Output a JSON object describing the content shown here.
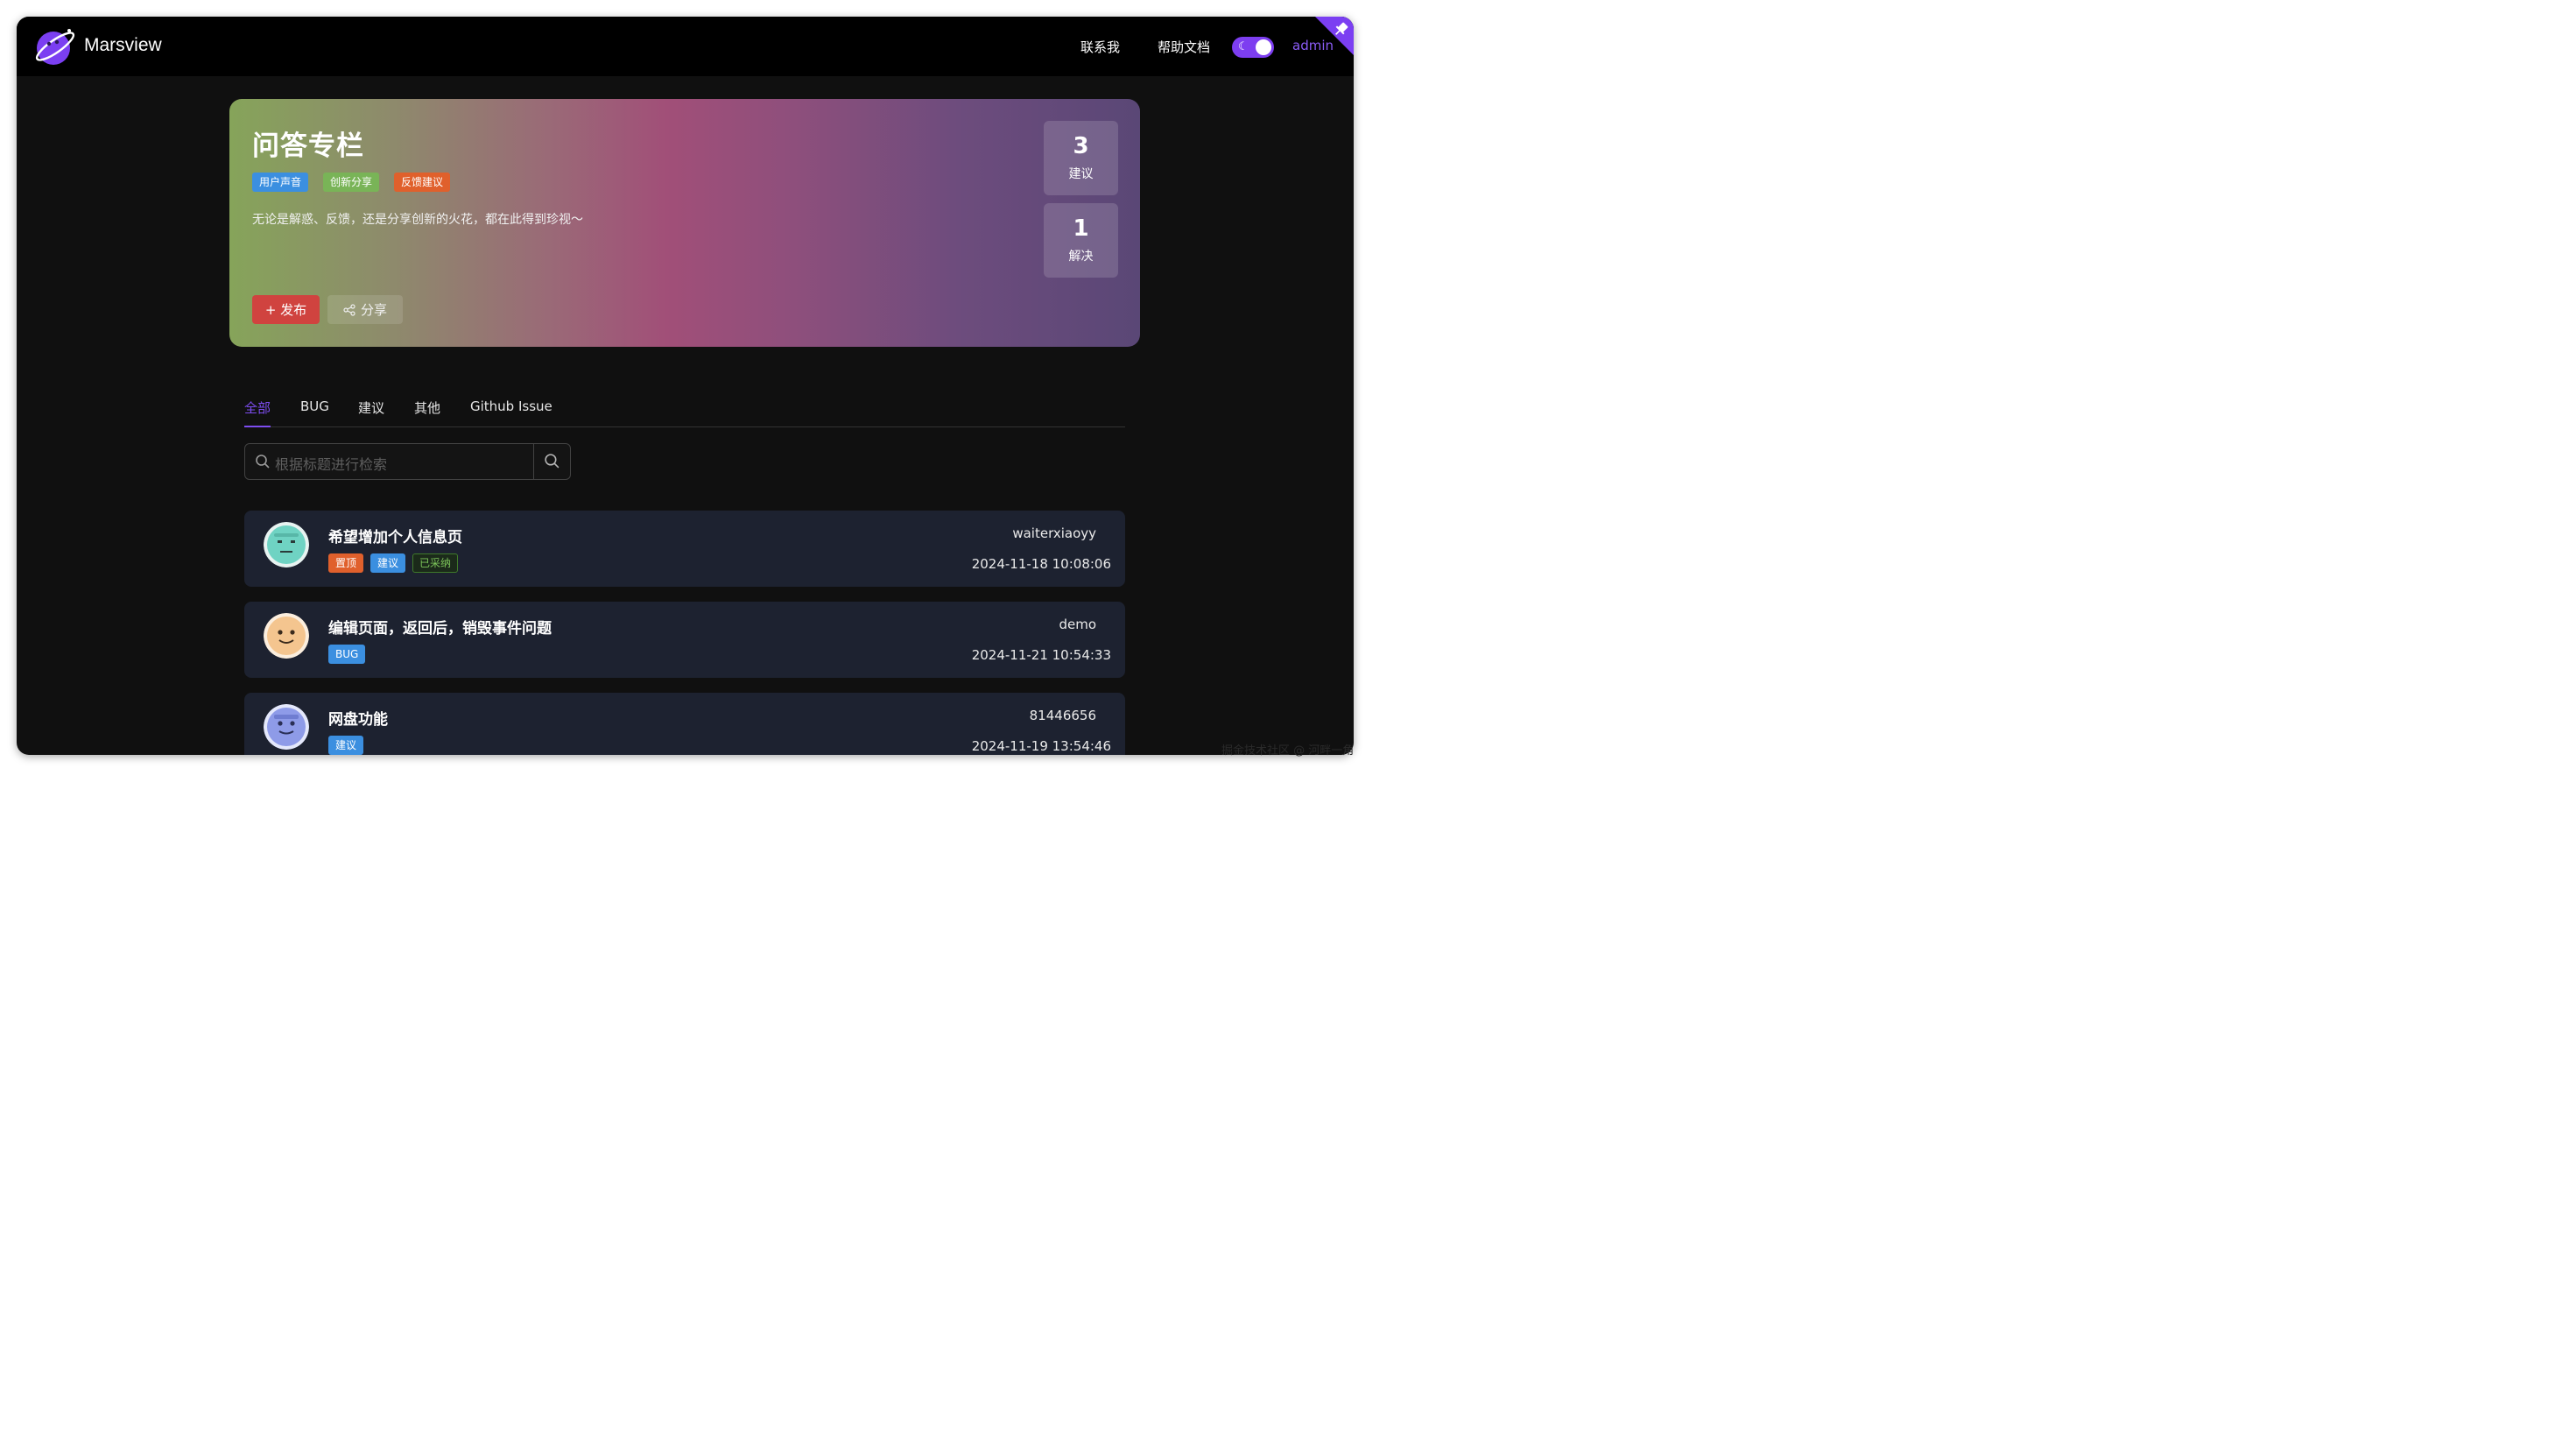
{
  "header": {
    "brand": "Marsview",
    "nav": [
      "联系我",
      "帮助文档"
    ],
    "user": "admin",
    "theme_toggle_icon": "moon-icon"
  },
  "hero": {
    "title": "问答专栏",
    "tags": [
      {
        "label": "用户声音",
        "color": "#3b8fe0"
      },
      {
        "label": "创新分享",
        "color": "#79b457"
      },
      {
        "label": "反馈建议",
        "color": "#e0602c"
      }
    ],
    "description": "无论是解惑、反馈，还是分享创新的火花，都在此得到珍视～",
    "publish_label": "+ 发布",
    "share_label": "分享",
    "stats": [
      {
        "value": "3",
        "label": "建议"
      },
      {
        "value": "1",
        "label": "解决"
      }
    ]
  },
  "tabs": {
    "items": [
      "全部",
      "BUG",
      "建议",
      "其他",
      "Github Issue"
    ],
    "active": "全部"
  },
  "search": {
    "placeholder": "根据标题进行检索"
  },
  "posts": [
    {
      "title": "希望增加个人信息页",
      "tags": [
        {
          "label": "置顶",
          "color": "#e0602c"
        },
        {
          "label": "建议",
          "color": "#3b8fe0"
        },
        {
          "label": "已采纳",
          "color": "#7cc45a"
        }
      ],
      "author": "waiterxiaoyy",
      "time": "2024-11-18 10:08:06",
      "avatar_color": "#6fd3c3"
    },
    {
      "title": "编辑页面，返回后，销毁事件问题",
      "tags": [
        {
          "label": "BUG",
          "color": "#3b8fe0"
        }
      ],
      "author": "demo",
      "time": "2024-11-21 10:54:33",
      "avatar_color": "#f4c58f"
    },
    {
      "title": "网盘功能",
      "tags": [
        {
          "label": "建议",
          "color": "#3b8fe0"
        }
      ],
      "author": "81446656",
      "time": "2024-11-19 13:54:46",
      "avatar_color": "#8e9be8"
    }
  ],
  "watermark": "掘金技术社区 @ 河畔一角"
}
